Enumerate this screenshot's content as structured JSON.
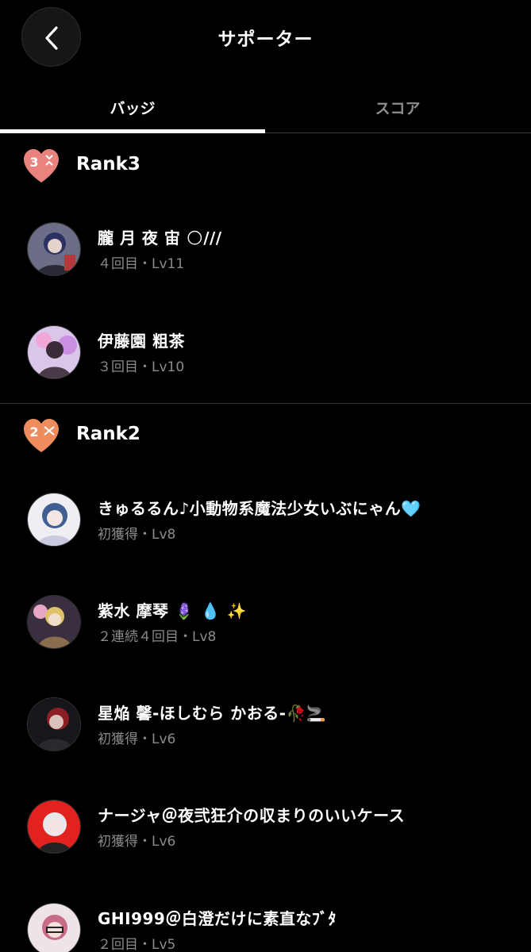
{
  "header": {
    "title": "サポーター",
    "back_icon": "chevron-left-icon"
  },
  "tabs": [
    {
      "label": "バッジ",
      "active": true
    },
    {
      "label": "スコア",
      "active": false
    }
  ],
  "sections": [
    {
      "rank_badge_number": "3",
      "rank_label": "Rank3",
      "badge_color": "#e9837e",
      "supporters": [
        {
          "name": "朧 月 夜 宙 🌕///",
          "meta": "４回目・Lv11"
        },
        {
          "name": "伊藤園 粗茶",
          "meta": "３回目・Lv10"
        }
      ]
    },
    {
      "rank_badge_number": "2",
      "rank_label": "Rank2",
      "badge_color": "#ef8c5e",
      "supporters": [
        {
          "name": "きゅるるん♪小動物系魔法少女いぶにゃん🩵",
          "meta": "初獲得・Lv8"
        },
        {
          "name": "紫水 摩琴 🪻 💧 ✨",
          "meta": "２連続４回目・Lv8"
        },
        {
          "name": "星焔 馨-ほしむら かおる-🥀🚬",
          "meta": "初獲得・Lv6"
        },
        {
          "name": "ナージャ＠夜弐狂介の収まりのいいケース",
          "meta": "初獲得・Lv6"
        },
        {
          "name": "GHI999＠白澄だけに素直なﾌﾞﾀ",
          "meta": "２回目・Lv5"
        }
      ]
    }
  ]
}
